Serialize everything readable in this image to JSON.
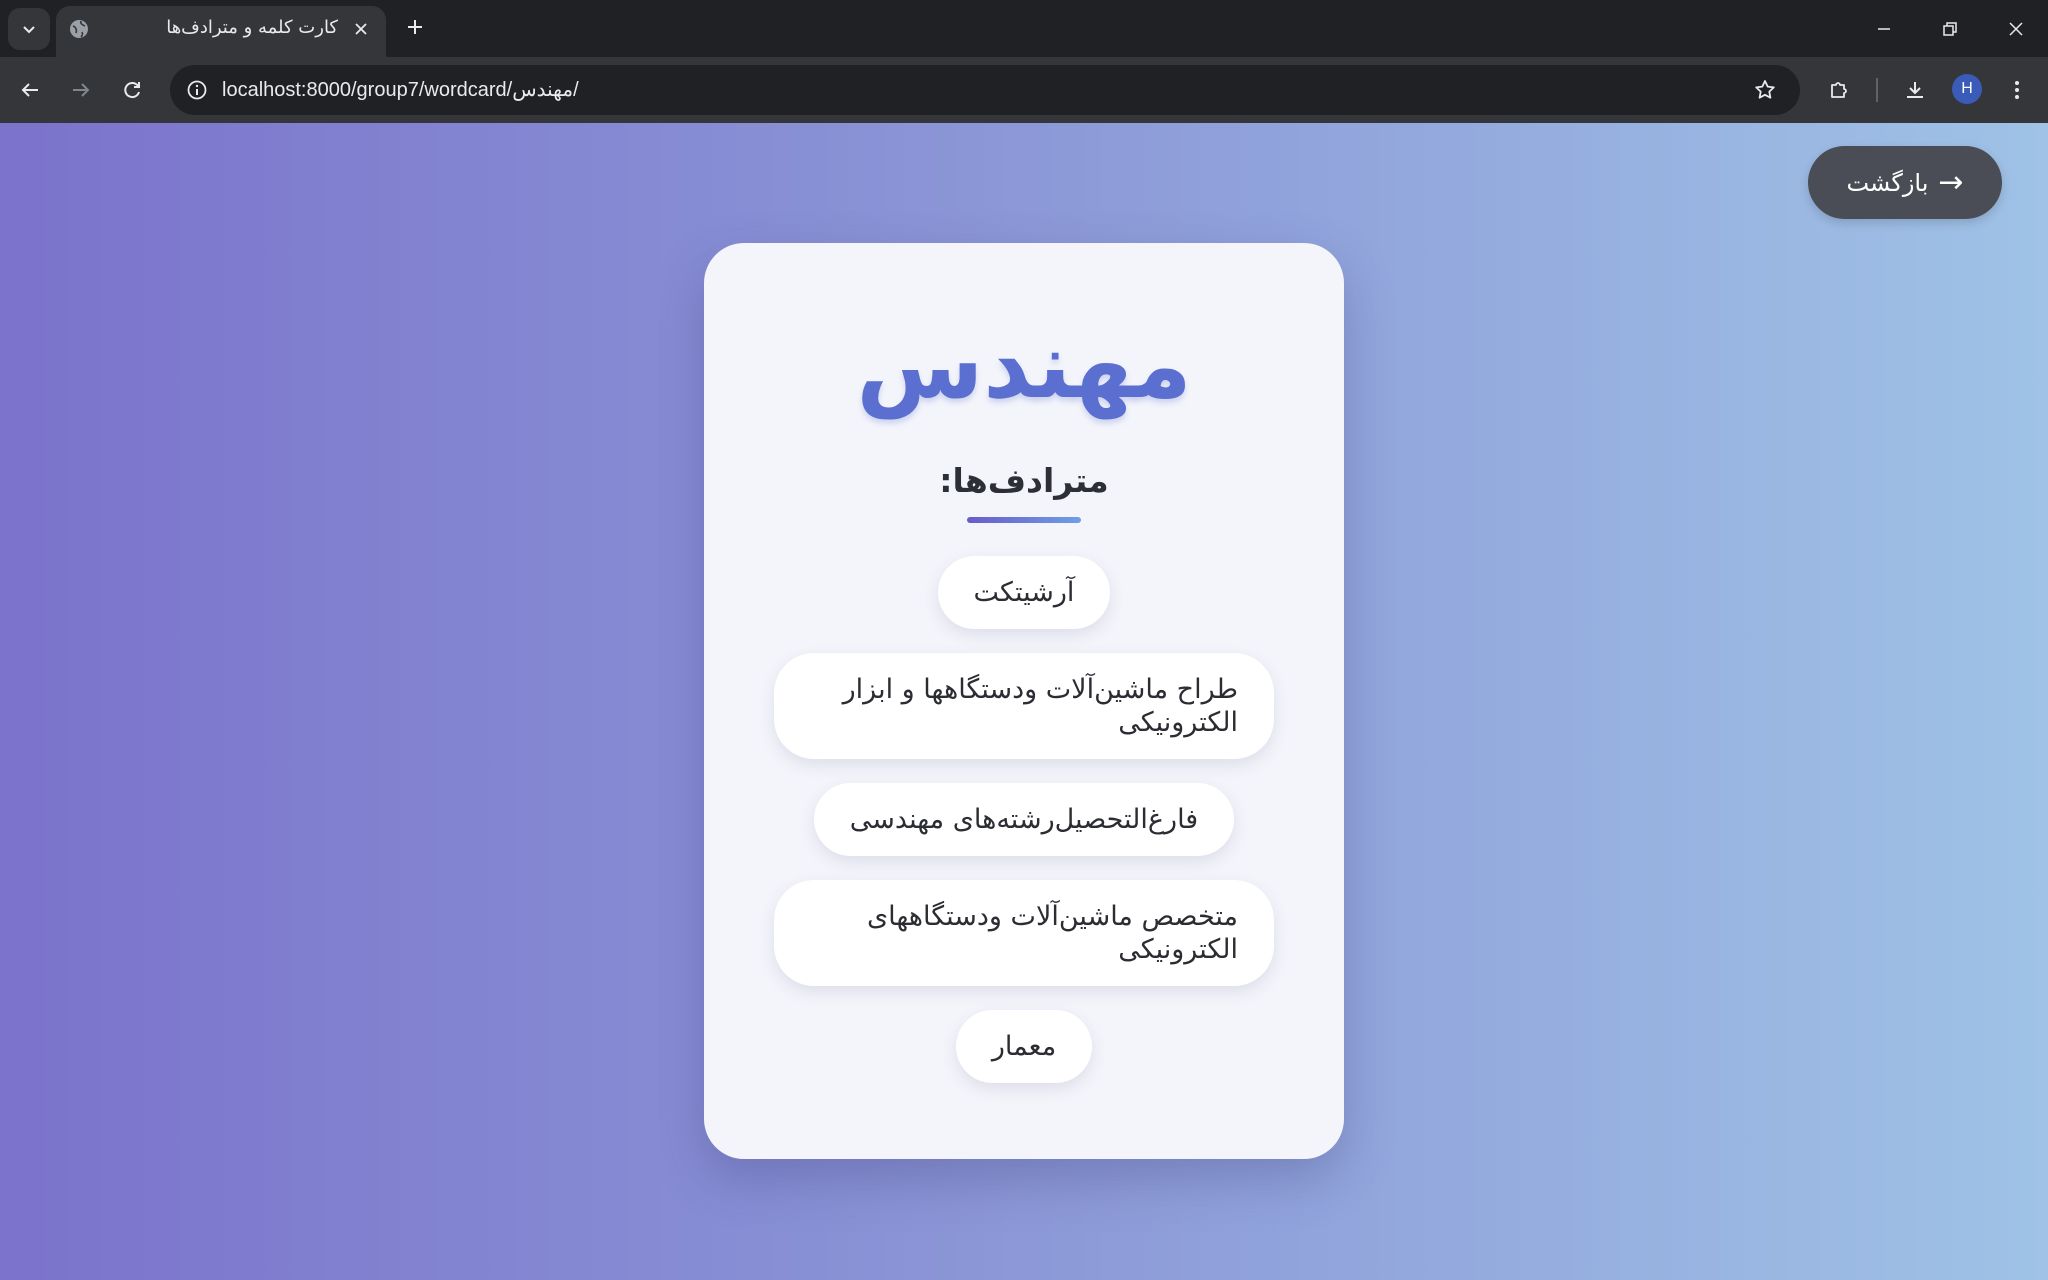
{
  "browser": {
    "tab_title": "کارت کلمه و مترادف‌ها",
    "url": "localhost:8000/group7/wordcard/مهندس/",
    "profile_initial": "H"
  },
  "page": {
    "back_label": "بازگشت",
    "back_arrow": "→",
    "word": "مهندس",
    "synonyms_heading": "مترادف‌ها:",
    "synonyms": [
      "آرشیتکت",
      "طراح ماشین‌آلات ودستگاهها و ابزار الکترونیکی",
      "فارغ‌التحصیل‌رشته‌های مهندسی",
      "متخصص ماشین‌آلات ودستگاههای الکترونیکی",
      "معمار"
    ]
  },
  "colors": {
    "gradient_start": "#7b73cc",
    "gradient_end": "#9fc2e6",
    "title_color": "#5a6fcf",
    "back_button_bg": "#4a4d55"
  },
  "icons": {
    "tab_search": "chevron-down-icon",
    "favicon": "globe-icon",
    "tab_close": "close-icon",
    "new_tab": "plus-icon",
    "back": "arrow-left-icon",
    "forward": "arrow-right-icon",
    "reload": "reload-icon",
    "site_info": "info-icon",
    "bookmark": "star-icon",
    "extensions": "puzzle-icon",
    "downloads": "download-icon",
    "menu": "kebab-menu-icon"
  }
}
